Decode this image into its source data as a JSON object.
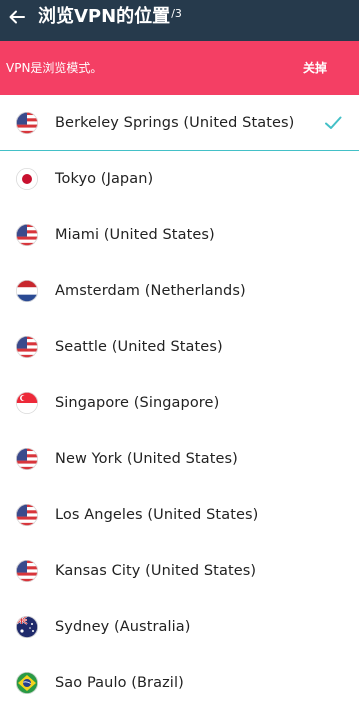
{
  "header": {
    "title": "浏览VPN的位置",
    "superscript": "/3",
    "back_icon": "arrow-left-icon"
  },
  "banner": {
    "message": "VPN是浏览模式。",
    "close_label": "关掉"
  },
  "colors": {
    "appbar": "#263a4c",
    "banner": "#f43f64",
    "accent": "#43c0c7"
  },
  "locations": [
    {
      "label": "Berkeley Springs (United States)",
      "flag": "us-flag-icon",
      "selected": true
    },
    {
      "label": "Tokyo (Japan)",
      "flag": "jp-flag-icon",
      "selected": false
    },
    {
      "label": "Miami (United States)",
      "flag": "us-flag-icon",
      "selected": false
    },
    {
      "label": "Amsterdam (Netherlands)",
      "flag": "nl-flag-icon",
      "selected": false
    },
    {
      "label": "Seattle (United States)",
      "flag": "us-flag-icon",
      "selected": false
    },
    {
      "label": "Singapore (Singapore)",
      "flag": "sg-flag-icon",
      "selected": false
    },
    {
      "label": "New York (United States)",
      "flag": "us-flag-icon",
      "selected": false
    },
    {
      "label": "Los Angeles (United States)",
      "flag": "us-flag-icon",
      "selected": false
    },
    {
      "label": "Kansas City (United States)",
      "flag": "us-flag-icon",
      "selected": false
    },
    {
      "label": "Sydney (Australia)",
      "flag": "au-flag-icon",
      "selected": false
    },
    {
      "label": "Sao Paulo (Brazil)",
      "flag": "br-flag-icon",
      "selected": false
    }
  ]
}
